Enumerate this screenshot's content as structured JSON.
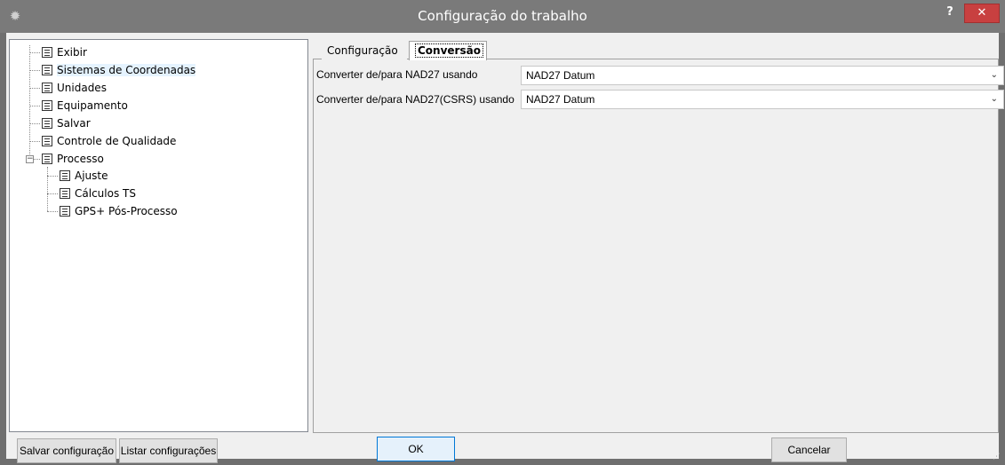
{
  "window": {
    "title": "Configuração do trabalho",
    "help_label": "?",
    "close_label": "✕"
  },
  "tree": {
    "items": [
      {
        "label": "Exibir"
      },
      {
        "label": "Sistemas de Coordenadas"
      },
      {
        "label": "Unidades"
      },
      {
        "label": "Equipamento"
      },
      {
        "label": "Salvar"
      },
      {
        "label": "Controle de Qualidade"
      },
      {
        "label": "Processo"
      },
      {
        "label": "Ajuste"
      },
      {
        "label": "Cálculos TS"
      },
      {
        "label": "GPS+ Pós-Processo"
      }
    ],
    "selected": "Sistemas de Coordenadas",
    "expander_symbol": "−"
  },
  "tabs": [
    {
      "label": "Configuração"
    },
    {
      "label": "Conversão"
    }
  ],
  "conversion": {
    "rows": [
      {
        "label": "Converter de/para NAD27 usando",
        "value": "NAD27 Datum"
      },
      {
        "label": "Converter de/para NAD27(CSRS) usando",
        "value": "NAD27 Datum"
      }
    ]
  },
  "footer": {
    "save_config": "Salvar configuração",
    "list_configs": "Listar configurações",
    "ok": "OK",
    "cancel": "Cancelar"
  },
  "colors": {
    "titlebar": "#7a7a7a",
    "close": "#c84040",
    "selection": "#e5f3ff"
  }
}
